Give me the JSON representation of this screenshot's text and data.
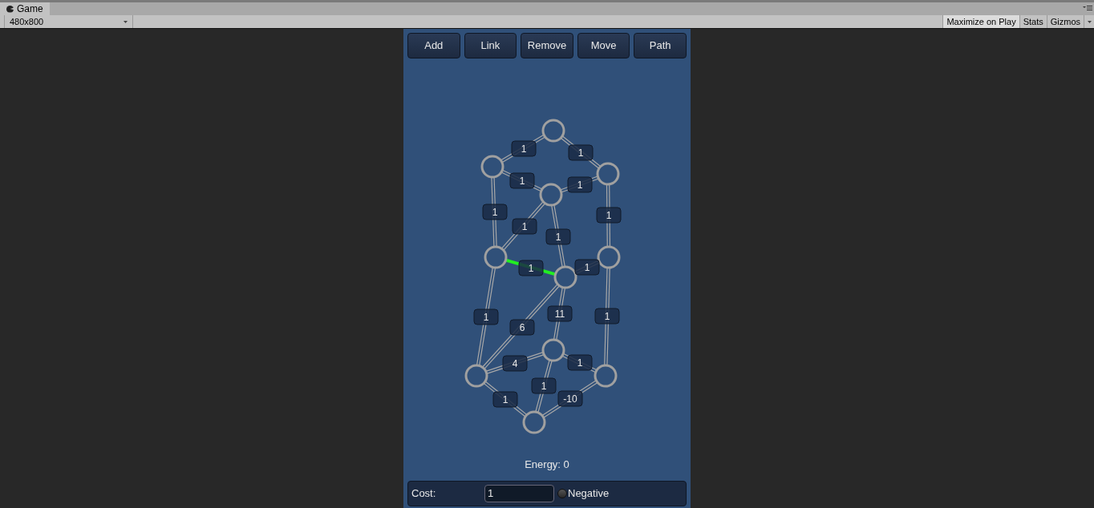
{
  "window": {
    "title": "Game"
  },
  "toolbar": {
    "resolution": "480x800",
    "buttons": [
      {
        "label": "Maximize on Play",
        "selected": true
      },
      {
        "label": "Stats",
        "selected": false
      },
      {
        "label": "Gizmos",
        "selected": false
      }
    ]
  },
  "tools": [
    {
      "label": "Add"
    },
    {
      "label": "Link"
    },
    {
      "label": "Remove"
    },
    {
      "label": "Move"
    },
    {
      "label": "Path"
    }
  ],
  "edges": [
    {
      "cost": "1",
      "highlighted": false
    },
    {
      "cost": "1",
      "highlighted": false
    },
    {
      "cost": "1",
      "highlighted": false
    },
    {
      "cost": "1",
      "highlighted": false
    },
    {
      "cost": "1",
      "highlighted": false
    },
    {
      "cost": "1",
      "highlighted": false
    },
    {
      "cost": "1",
      "highlighted": false
    },
    {
      "cost": "1",
      "highlighted": false
    },
    {
      "cost": "1",
      "highlighted": true
    },
    {
      "cost": "1",
      "highlighted": false
    },
    {
      "cost": "1",
      "highlighted": false
    },
    {
      "cost": "6",
      "highlighted": false
    },
    {
      "cost": "11",
      "highlighted": false
    },
    {
      "cost": "1",
      "highlighted": false
    },
    {
      "cost": "4",
      "highlighted": false
    },
    {
      "cost": "1",
      "highlighted": false
    },
    {
      "cost": "1",
      "highlighted": false
    },
    {
      "cost": "1",
      "highlighted": false
    },
    {
      "cost": "-10",
      "highlighted": false
    }
  ],
  "energy": "Energy: 0",
  "cost_panel": {
    "label": "Cost:",
    "value": "1",
    "negative": {
      "label": "Negative",
      "checked": false
    }
  }
}
